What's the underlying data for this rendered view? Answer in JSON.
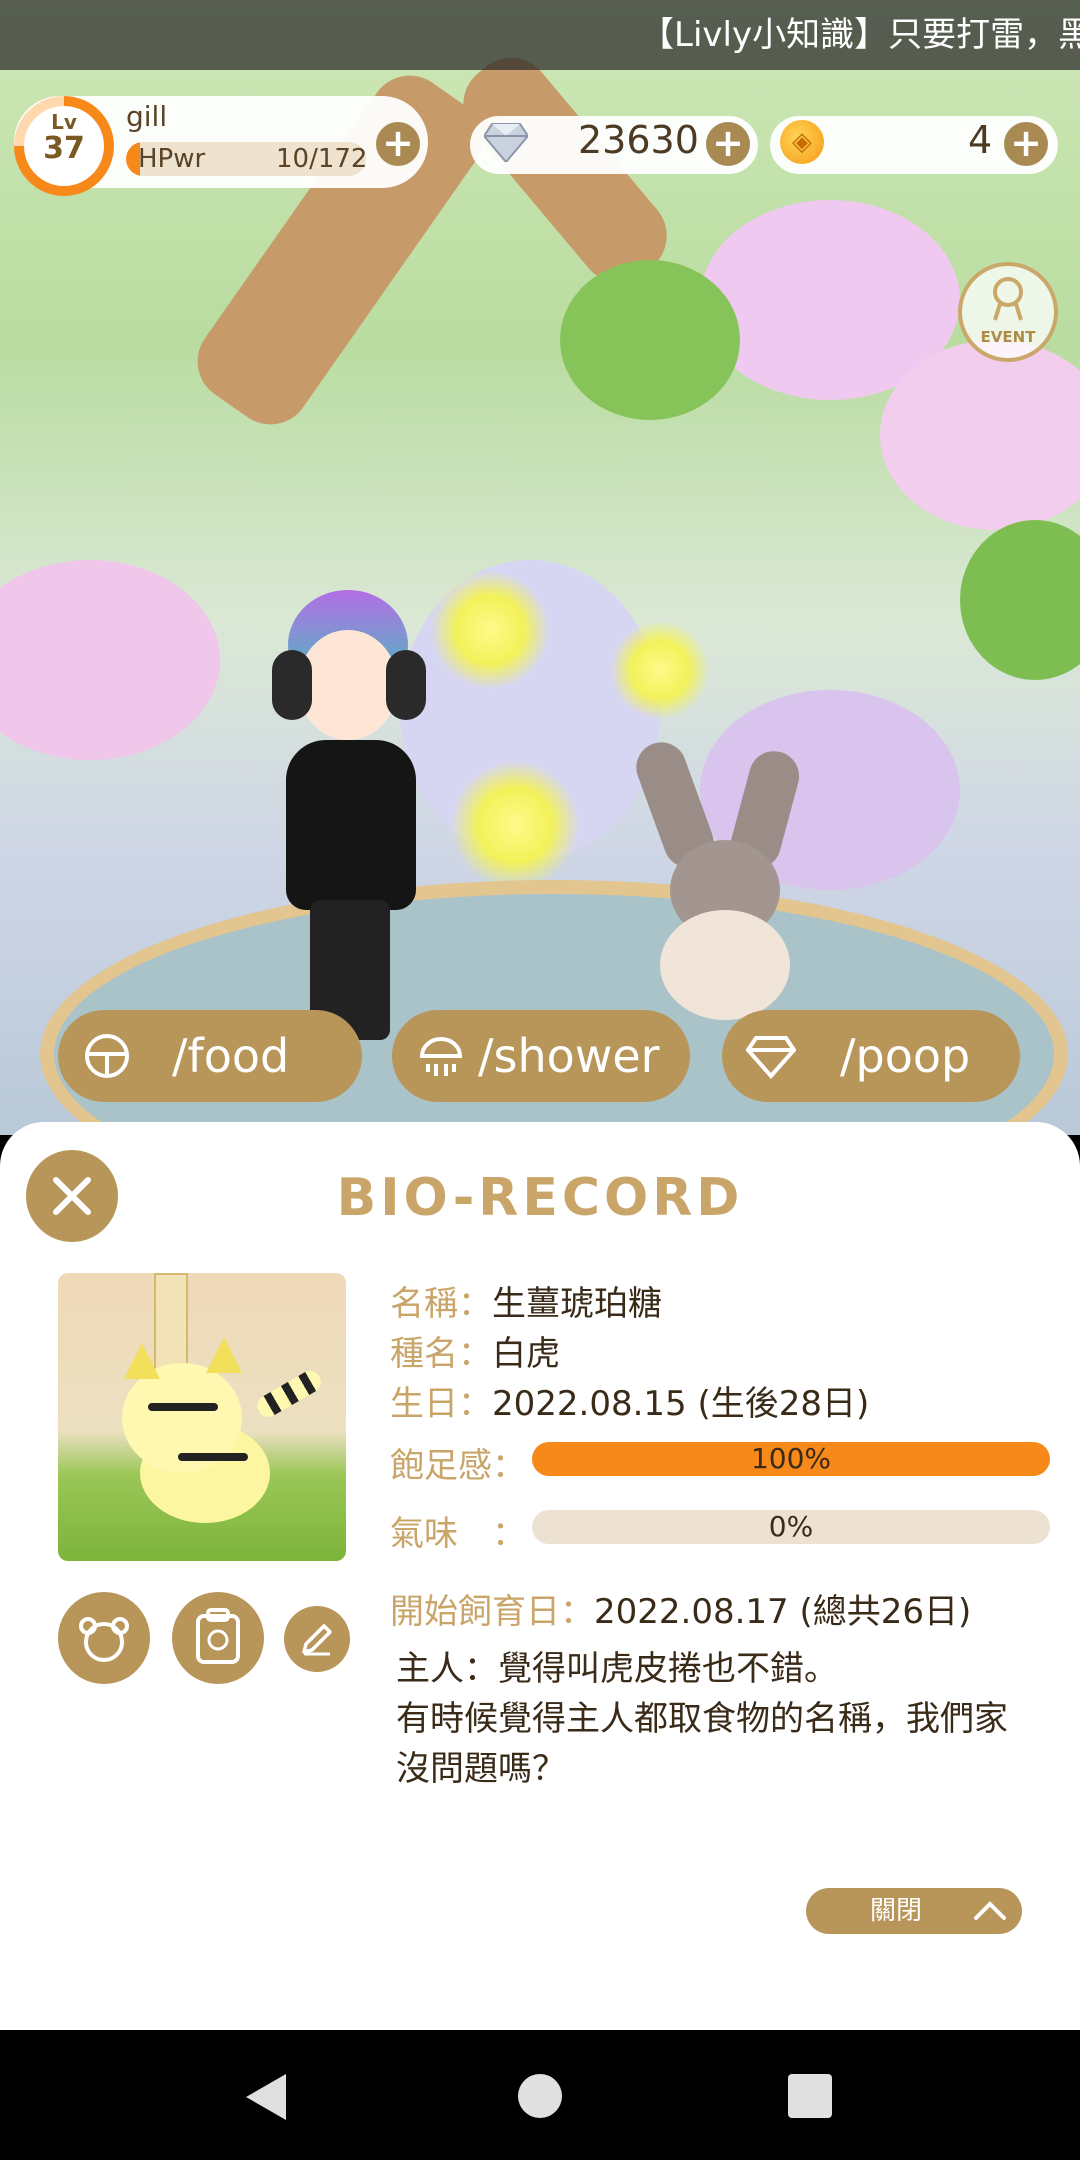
{
  "ticker": "【Livly小知識】只要打雷，黑",
  "player": {
    "level_label": "Lv",
    "level": "37",
    "name": "gill",
    "hp_label": "HPwr",
    "hp_value": "10/172",
    "hp_fraction": 0.058
  },
  "currency": {
    "gems": "23630",
    "coins": "4"
  },
  "event_button": "EVENT",
  "actions": [
    {
      "label": "/food",
      "icon": "food-bowl-icon"
    },
    {
      "label": "/shower",
      "icon": "shower-icon"
    },
    {
      "label": "/poop",
      "icon": "poop-icon"
    }
  ],
  "panel": {
    "title": "BIO-RECORD",
    "name_key": "名稱：",
    "name_val": "生薑琥珀糖",
    "species_key": "種名：",
    "species_val": "白虎",
    "birthday_key": "生日：",
    "birthday_val": "2022.08.15 (生後28日)",
    "satiety_key": "飽足感：",
    "satiety_val": "100%",
    "satiety_fraction": 1.0,
    "smell_key": "氣味　：",
    "smell_val": "0%",
    "smell_fraction": 0.0,
    "start_key": "開始飼育日：",
    "start_val": "2022.08.17 (總共26日)",
    "memo": "主人：覺得叫虎皮捲也不錯。\n有時候覺得主人都取食物的名稱，我們家沒問題嗎？",
    "close_label": "關閉"
  },
  "colors": {
    "accent": "#b8965a",
    "orange": "#f7891b",
    "title": "#c9a56a"
  }
}
